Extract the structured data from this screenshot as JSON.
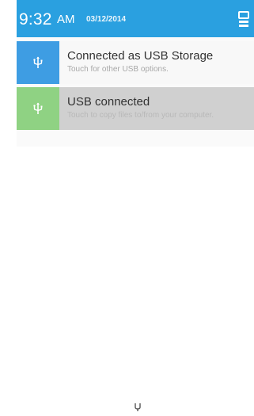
{
  "status_header": {
    "time": "9:32",
    "ampm": "AM",
    "date": "03/12/2014",
    "settings_icon": "quick-settings-icon"
  },
  "notifications": [
    {
      "title": "Connected as USB Storage",
      "subtitle": "Touch for other USB options.",
      "icon": "usb-icon",
      "icon_bg": "#3e9de3"
    },
    {
      "title": "USB connected",
      "subtitle": "Touch to copy files to/from your computer.",
      "icon": "usb-icon",
      "icon_bg": "#8fd283"
    }
  ],
  "colors": {
    "header": "#2aa0e0",
    "pressed_row": "#d0d0d0"
  }
}
